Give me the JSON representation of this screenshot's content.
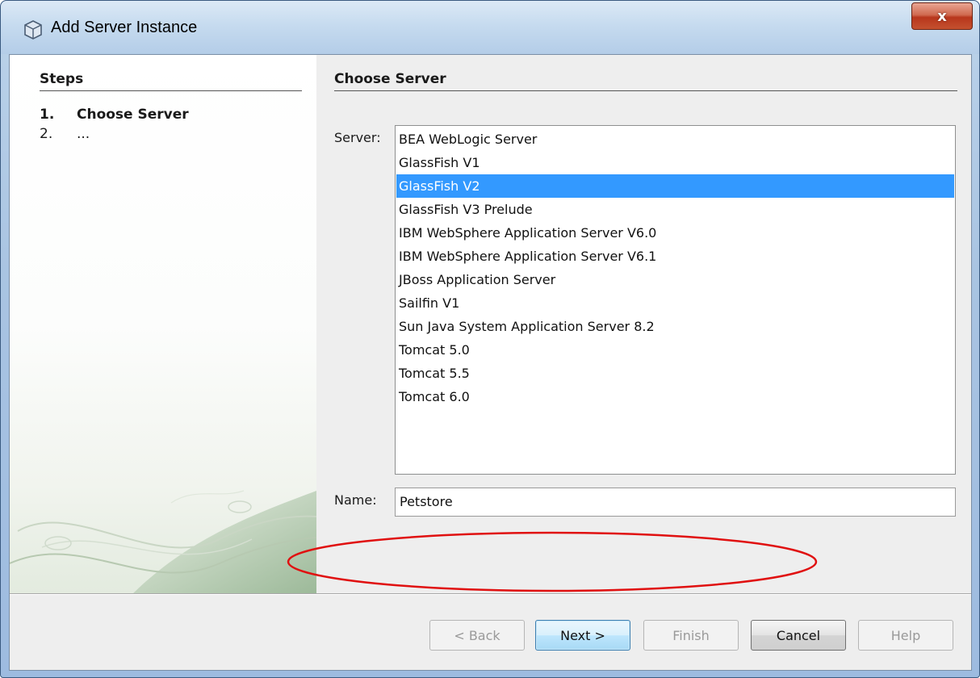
{
  "window": {
    "title": "Add Server Instance",
    "close_glyph": "x"
  },
  "steps": {
    "heading": "Steps",
    "items": [
      {
        "number": "1.",
        "label": "Choose Server"
      },
      {
        "number": "2.",
        "label": "..."
      }
    ]
  },
  "main": {
    "heading": "Choose Server",
    "server_label": "Server:",
    "servers": [
      "BEA WebLogic Server",
      "GlassFish V1",
      "GlassFish V2",
      "GlassFish V3 Prelude",
      "IBM WebSphere Application Server V6.0",
      "IBM WebSphere Application Server V6.1",
      "JBoss Application Server",
      "Sailfin V1",
      "Sun Java System Application Server 8.2",
      "Tomcat 5.0",
      "Tomcat 5.5",
      "Tomcat 6.0"
    ],
    "selected_server": "GlassFish V2",
    "name_label": "Name:",
    "name_value": "Petstore"
  },
  "buttons": {
    "back": "< Back",
    "next": "Next >",
    "finish": "Finish",
    "cancel": "Cancel",
    "help": "Help"
  },
  "colors": {
    "selection": "#3399ff",
    "annotation": "#e01010"
  }
}
